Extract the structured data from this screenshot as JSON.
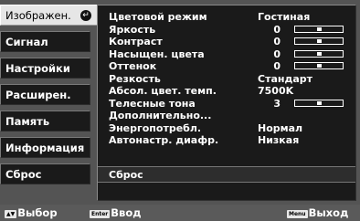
{
  "menu": {
    "tabs": [
      {
        "label": "Изображен."
      },
      {
        "label": "Сигнал"
      },
      {
        "label": "Настройки"
      },
      {
        "label": "Расширен."
      },
      {
        "label": "Память"
      },
      {
        "label": "Информация"
      },
      {
        "label": "Сброс"
      }
    ]
  },
  "panel": {
    "rows": [
      {
        "label": "Цветовой режим",
        "value": "Гостиная"
      },
      {
        "label": "Яркость",
        "value": "0",
        "level": 0.5
      },
      {
        "label": "Контраст",
        "value": "0",
        "level": 0.5
      },
      {
        "label": "Насыщен. цвета",
        "value": "0",
        "level": 0.5
      },
      {
        "label": "Оттенок",
        "value": "0",
        "level": 0.5
      },
      {
        "label": "Резкость",
        "value": "Стандарт"
      },
      {
        "label": "Абсол. цвет. темп.",
        "value": "7500K"
      },
      {
        "label": "Телесные тона",
        "value": "3",
        "level": 0.5
      },
      {
        "label": "Дополнительно..."
      },
      {
        "label": "Энергопотребл.",
        "value": "Нормал"
      },
      {
        "label": "Автонастр. диафр.",
        "value": "Низкая"
      }
    ],
    "reset_label": "Сброс"
  },
  "footer": {
    "select_key": "▲▼",
    "select_label": "Выбор",
    "enter_key": "Enter",
    "enter_label": "Ввод",
    "menu_key": "Menu",
    "menu_label": "Выход"
  }
}
